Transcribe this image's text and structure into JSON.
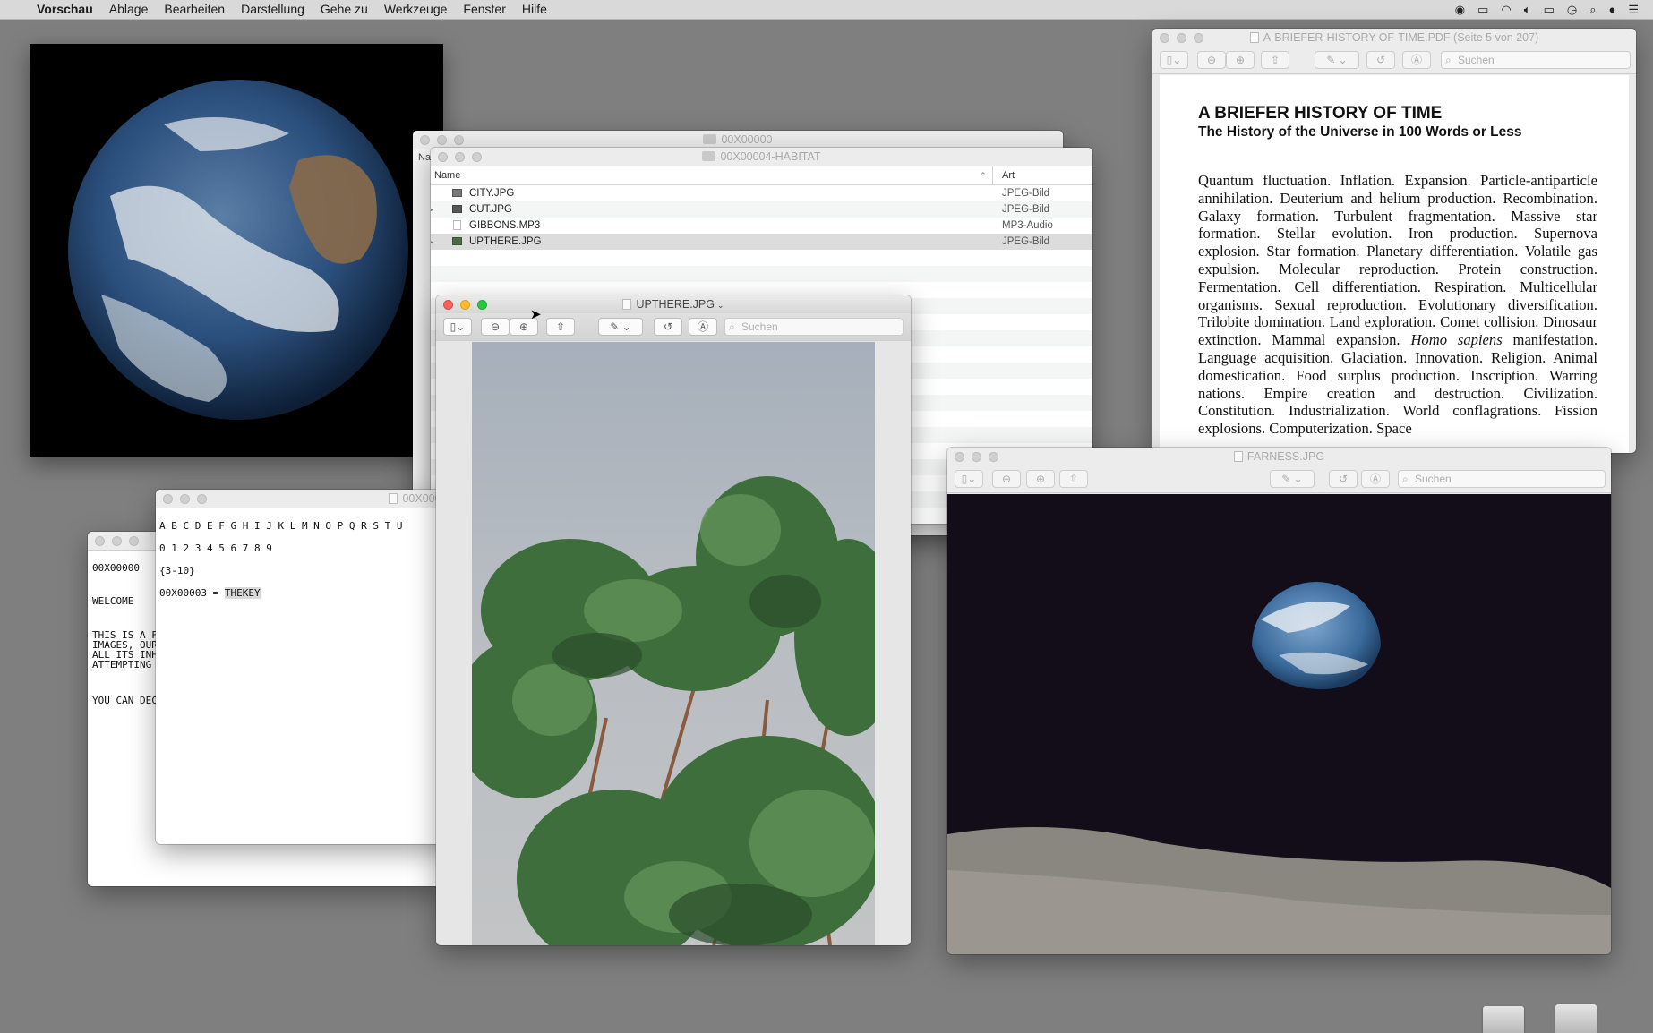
{
  "menubar": {
    "app": "Vorschau",
    "items": [
      "Ablage",
      "Bearbeiten",
      "Darstellung",
      "Gehe zu",
      "Werkzeuge",
      "Fenster",
      "Hilfe"
    ]
  },
  "finder_back": {
    "title": "00X00000"
  },
  "finder": {
    "title": "00X00004-HABITAT",
    "col_name": "Name",
    "col_kind": "Art",
    "col_name_back": "Na",
    "files": [
      {
        "name": "CITY.JPG",
        "kind": "JPEG-Bild"
      },
      {
        "name": "CUT.JPG",
        "kind": "JPEG-Bild"
      },
      {
        "name": "GIBBONS.MP3",
        "kind": "MP3-Audio"
      },
      {
        "name": "UPTHERE.JPG",
        "kind": "JPEG-Bild"
      }
    ]
  },
  "upthere": {
    "title": "UPTHERE.JPG",
    "search_placeholder": "Suchen"
  },
  "pdf": {
    "title": "A-BRIEFER-HISTORY-OF-TIME.PDF (Seite 5 von 207)",
    "search_placeholder": "Suchen",
    "heading": "A BRIEFER HISTORY OF TIME",
    "subheading": "The History of the Universe in 100 Words or Less",
    "body_before_italic": "Quantum fluctuation. Inflation. Expansion. Particle-antiparticle annihilation. Deuterium and helium production. Recombination. Galaxy formation. Turbulent fragmentation. Massive star formation. Stellar evolution. Iron production. Supernova explosion. Star formation. Planetary differentiation. Volatile gas expulsion. Molecular reproduction. Protein construction. Fermentation. Cell differentiation. Respiration. Multicellular organisms. Sexual reproduction. Evolutionary diversification. Trilobite domination. Land exploration. Comet collision. Dinosaur extinction. Mammal expansion. ",
    "body_italic": "Homo sapiens",
    "body_after_italic": " manifestation. Language acquisition. Glaciation. Innovation. Religion. Animal domestication. Food surplus production. Inscription. Warring nations. Empire creation and destruction. Civilization. Constitution. Industrialization. World conflagrations. Fission explosions. Computerization. Space"
  },
  "farness": {
    "title": "FARNESS.JPG",
    "search_placeholder": "Suchen"
  },
  "text_back": {
    "lines": [
      "00X00000",
      "WELCOME",
      "THIS IS A F",
      "IMAGES, OUR",
      "ALL ITS INH",
      "ATTEMPTING",
      "YOU CAN DEC"
    ]
  },
  "text_front": {
    "title": "00X0000",
    "alphabet": "A B C D E F G H I J K L M N O P Q R S T U",
    "digits": "0 1 2 3 4 5 6 7 8 9",
    "range": "{3-10}",
    "key_prefix": "00X00003 = ",
    "key_value": "THEKEY"
  },
  "colors": {
    "desktop": "#7f7f7f",
    "space": "#0f0a14",
    "sky": "#aeb6c1",
    "highlight": "#d9d9d9"
  }
}
